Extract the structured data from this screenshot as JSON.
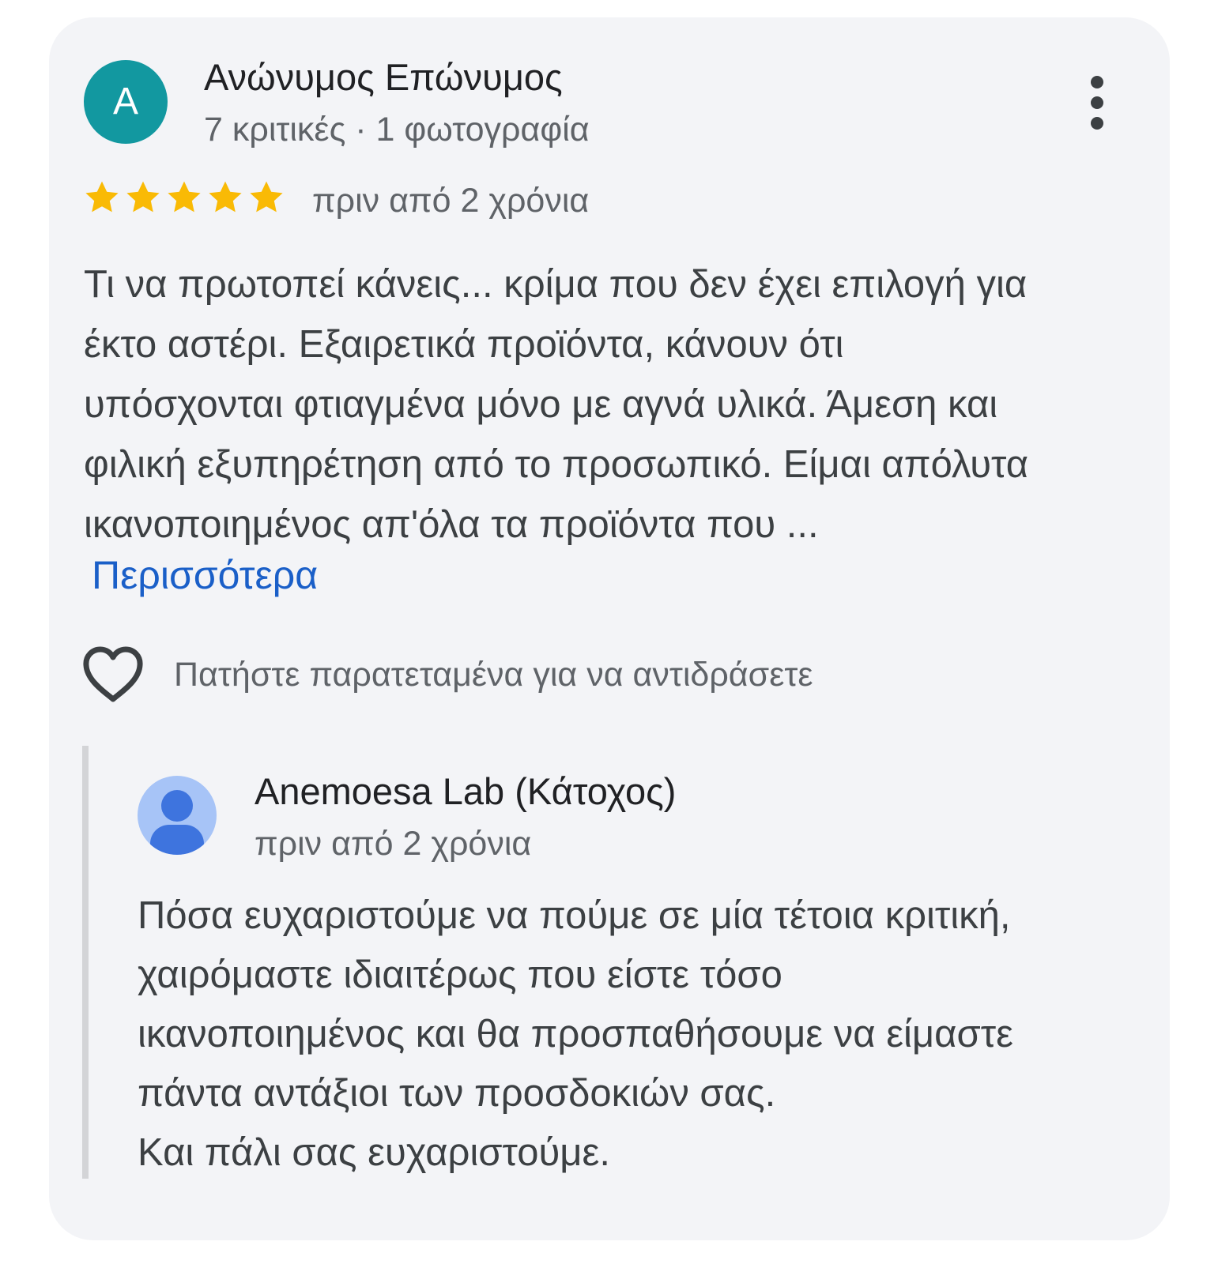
{
  "review": {
    "avatar_letter": "A",
    "avatar_color": "#1298a0",
    "author_name": "Ανώνυμος Επώνυμος",
    "author_meta": "7 κριτικές · 1 φωτογραφία",
    "rating": 5,
    "rating_max": 5,
    "star_color": "#f9ba05",
    "date": "πριν από 2 χρόνια",
    "text_lines": [
      "Τι να πρωτοπεί κάνεις... κρίμα που δεν έχει επιλογή για",
      "έκτο αστέρι. Εξαιρετικά προϊόντα, κάνουν ότι",
      "υπόσχονται φτιαγμένα μόνο με αγνά υλικά. Άμεση και",
      "φιλική εξυπηρέτηση από το προσωπικό. Είμαι απόλυτα",
      "ικανοποιημένος απ'όλα τα προϊόντα που ..."
    ],
    "more_link": "Περισσότερα",
    "link_color": "#1a5fc8",
    "react_icon": "heart-outline-icon",
    "react_label": "Πατήστε παρατεταμένα για να αντιδράσετε",
    "more_menu_icon": "more-vertical-icon"
  },
  "reply": {
    "owner_name": "Anemoesa Lab (Κάτοχος)",
    "avatar_icon": "person-icon",
    "avatar_color": "#a7c4f7",
    "date": "πριν από 2 χρόνια",
    "text_lines": [
      "Πόσα ευχαριστούμε να πούμε σε μία τέτοια κριτική,",
      "χαιρόμαστε ιδιαιτέρως που είστε τόσο",
      "ικανοποιημένος και θα προσπαθήσουμε να είμαστε",
      "πάντα αντάξιοι των προσδοκιών σας.",
      "Και πάλι σας ευχαριστούμε."
    ]
  }
}
